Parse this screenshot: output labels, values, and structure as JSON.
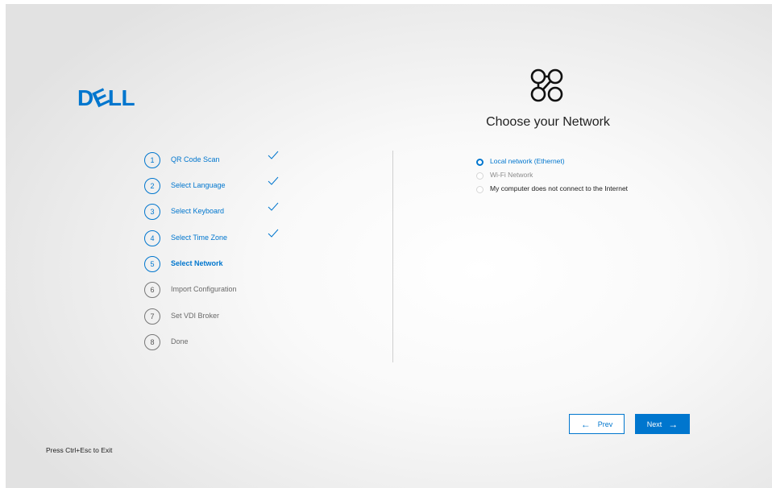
{
  "brand": {
    "logo_text": "DELL",
    "accent_color": "#0076ce"
  },
  "panel": {
    "icon": "network-icon",
    "title": "Choose your Network"
  },
  "steps": [
    {
      "number": "1",
      "label": "QR Code Scan",
      "status": "completed"
    },
    {
      "number": "2",
      "label": "Select Language",
      "status": "completed"
    },
    {
      "number": "3",
      "label": "Select Keyboard",
      "status": "completed"
    },
    {
      "number": "4",
      "label": "Select Time Zone",
      "status": "completed"
    },
    {
      "number": "5",
      "label": "Select Network",
      "status": "current"
    },
    {
      "number": "6",
      "label": "Import Configuration",
      "status": "pending"
    },
    {
      "number": "7",
      "label": "Set VDI Broker",
      "status": "pending"
    },
    {
      "number": "8",
      "label": "Done",
      "status": "pending"
    }
  ],
  "network_options": [
    {
      "label": "Local network (Ethernet)",
      "selected": true,
      "disabled": false
    },
    {
      "label": "Wi-Fi Network",
      "selected": false,
      "disabled": true
    },
    {
      "label": "My computer does not connect to the Internet",
      "selected": false,
      "disabled": false
    }
  ],
  "buttons": {
    "prev_label": "Prev",
    "next_label": "Next"
  },
  "footer": {
    "exit_hint": "Press Ctrl+Esc to Exit"
  }
}
